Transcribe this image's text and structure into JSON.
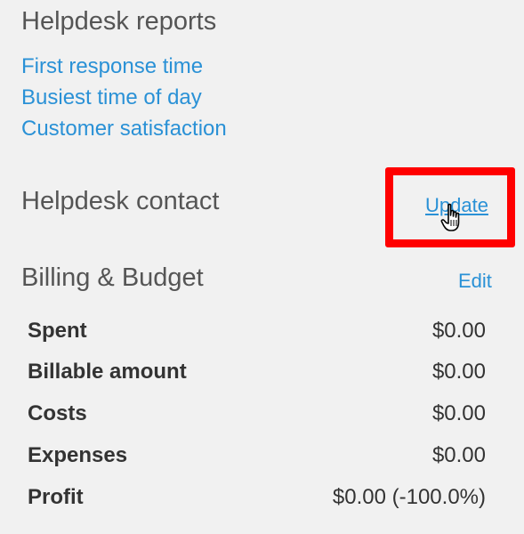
{
  "helpdesk_reports": {
    "title": "Helpdesk reports",
    "links": [
      "First response time",
      "Busiest time of day",
      "Customer satisfaction"
    ]
  },
  "helpdesk_contact": {
    "title": "Helpdesk contact",
    "action_label": "Update"
  },
  "billing": {
    "title": "Billing & Budget",
    "action_label": "Edit",
    "rows": [
      {
        "label": "Spent",
        "value": "$0.00"
      },
      {
        "label": "Billable amount",
        "value": "$0.00"
      },
      {
        "label": "Costs",
        "value": "$0.00"
      },
      {
        "label": "Expenses",
        "value": "$0.00"
      },
      {
        "label": "Profit",
        "value": "$0.00 (-100.0%)"
      }
    ]
  },
  "colors": {
    "link": "#2a91d6",
    "heading": "#555555",
    "highlight": "#ff0000",
    "background": "#f1f1f1"
  },
  "icons": {
    "cursor": "hand-pointer-icon"
  }
}
